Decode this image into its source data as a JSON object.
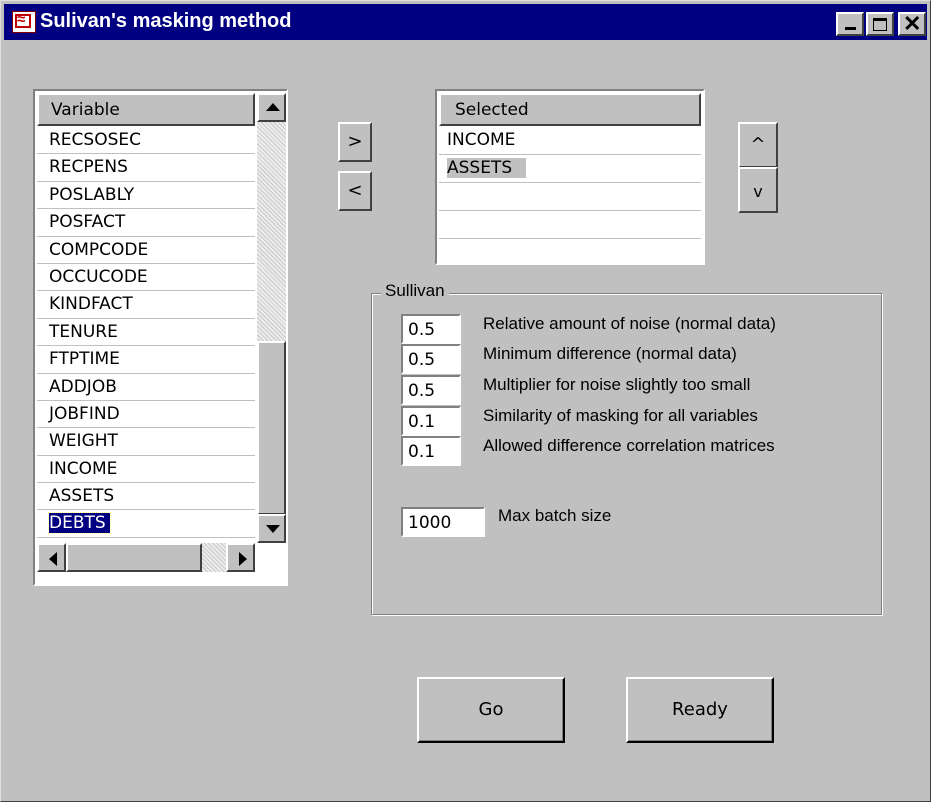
{
  "window": {
    "title": "Sulivan's masking method"
  },
  "variables": {
    "header": "Variable",
    "items": [
      "RECSOSEC",
      "RECPENS",
      "POSLABLY",
      "POSFACT",
      "COMPCODE",
      "OCCUCODE",
      "KINDFACT",
      "TENURE",
      "FTPTIME",
      "ADDJOB",
      "JOBFIND",
      "WEIGHT",
      "INCOME",
      "ASSETS",
      "DEBTS"
    ],
    "selected_item": "DEBTS"
  },
  "move": {
    "add_label": ">",
    "remove_label": "<"
  },
  "order": {
    "up_label": "^",
    "down_label": "v"
  },
  "selected": {
    "header": "Selected",
    "items": [
      "INCOME",
      "ASSETS",
      "",
      "",
      ""
    ],
    "highlighted_item": "ASSETS"
  },
  "sullivan": {
    "label": "Sullivan",
    "params": [
      {
        "value": "0.5",
        "label": "Relative amount of noise (normal data)"
      },
      {
        "value": "0.5",
        "label": "Minimum difference (normal data)"
      },
      {
        "value": "0.5",
        "label": "Multiplier for noise slightly too small"
      },
      {
        "value": "0.1",
        "label": "Similarity of masking for all variables"
      },
      {
        "value": "0.1",
        "label": "Allowed difference correlation matrices"
      }
    ],
    "batch": {
      "value": "1000",
      "label": "Max batch size"
    }
  },
  "actions": {
    "go_label": "Go",
    "ready_label": "Ready"
  }
}
